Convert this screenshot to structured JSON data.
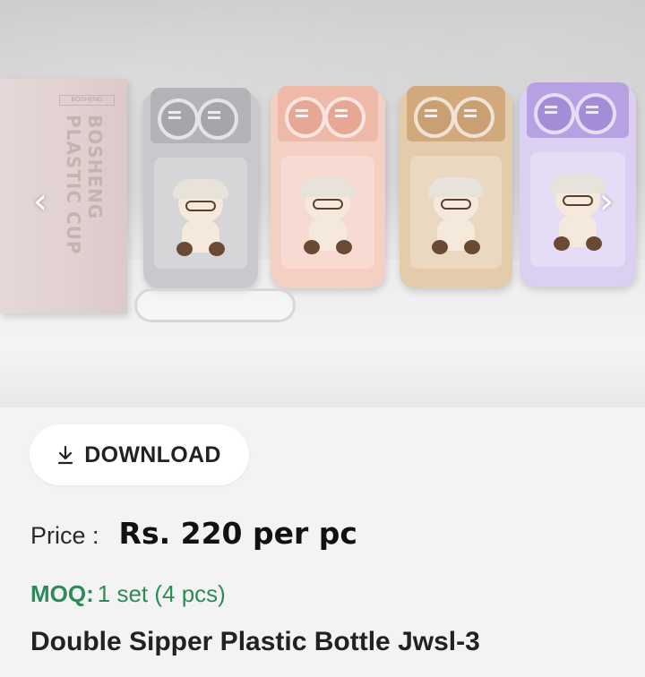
{
  "gallery": {
    "image_alt": "Double Sipper Plastic Bottle product photo",
    "box_brand": "BOSHENG",
    "box_text": "BOSHENG PLASTIC CUP",
    "prev_icon": "chevron-left-icon",
    "next_icon": "chevron-right-icon",
    "bottle_colors": [
      "#b9b9bd",
      "#f0c2b4",
      "#d7b58f",
      "#c7b5e6"
    ]
  },
  "actions": {
    "download_label": "DOWNLOAD",
    "download_icon": "download-icon"
  },
  "product": {
    "price_label": "Price :",
    "price_value": "Rs. 220 per pc",
    "moq_label": "MOQ:",
    "moq_value": "1 set (4 pcs)",
    "title": "Double Sipper Plastic Bottle Jwsl-3"
  },
  "colors": {
    "moq_green": "#2e8b57"
  }
}
